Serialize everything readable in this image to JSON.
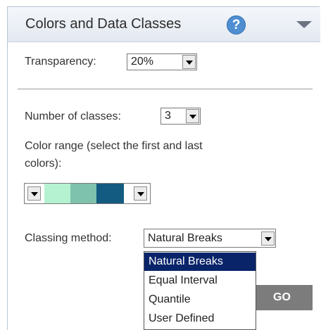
{
  "panel": {
    "title": "Colors and Data Classes",
    "help_icon": "?",
    "icons": {
      "help": "question-circle-icon",
      "collapse": "triangle-down-icon"
    },
    "transparency": {
      "label": "Transparency:",
      "value": "20%"
    },
    "classes": {
      "label": "Number of classes:",
      "value": "3"
    },
    "color_range": {
      "label_line1": "Color range (select the first and last",
      "label_line2": "colors):",
      "colors": [
        "#b5f2d2",
        "#7ec2ad",
        "#135b80"
      ]
    },
    "classing": {
      "label": "Classing method:",
      "value": "Natural Breaks",
      "options": [
        "Natural Breaks",
        "Equal Interval",
        "Quantile",
        "User Defined"
      ]
    },
    "go_button": "GO"
  },
  "colors": {
    "selected_bg": "#0a246a",
    "help": "#4f8fd1",
    "go_bg": "#7c7c7c"
  }
}
